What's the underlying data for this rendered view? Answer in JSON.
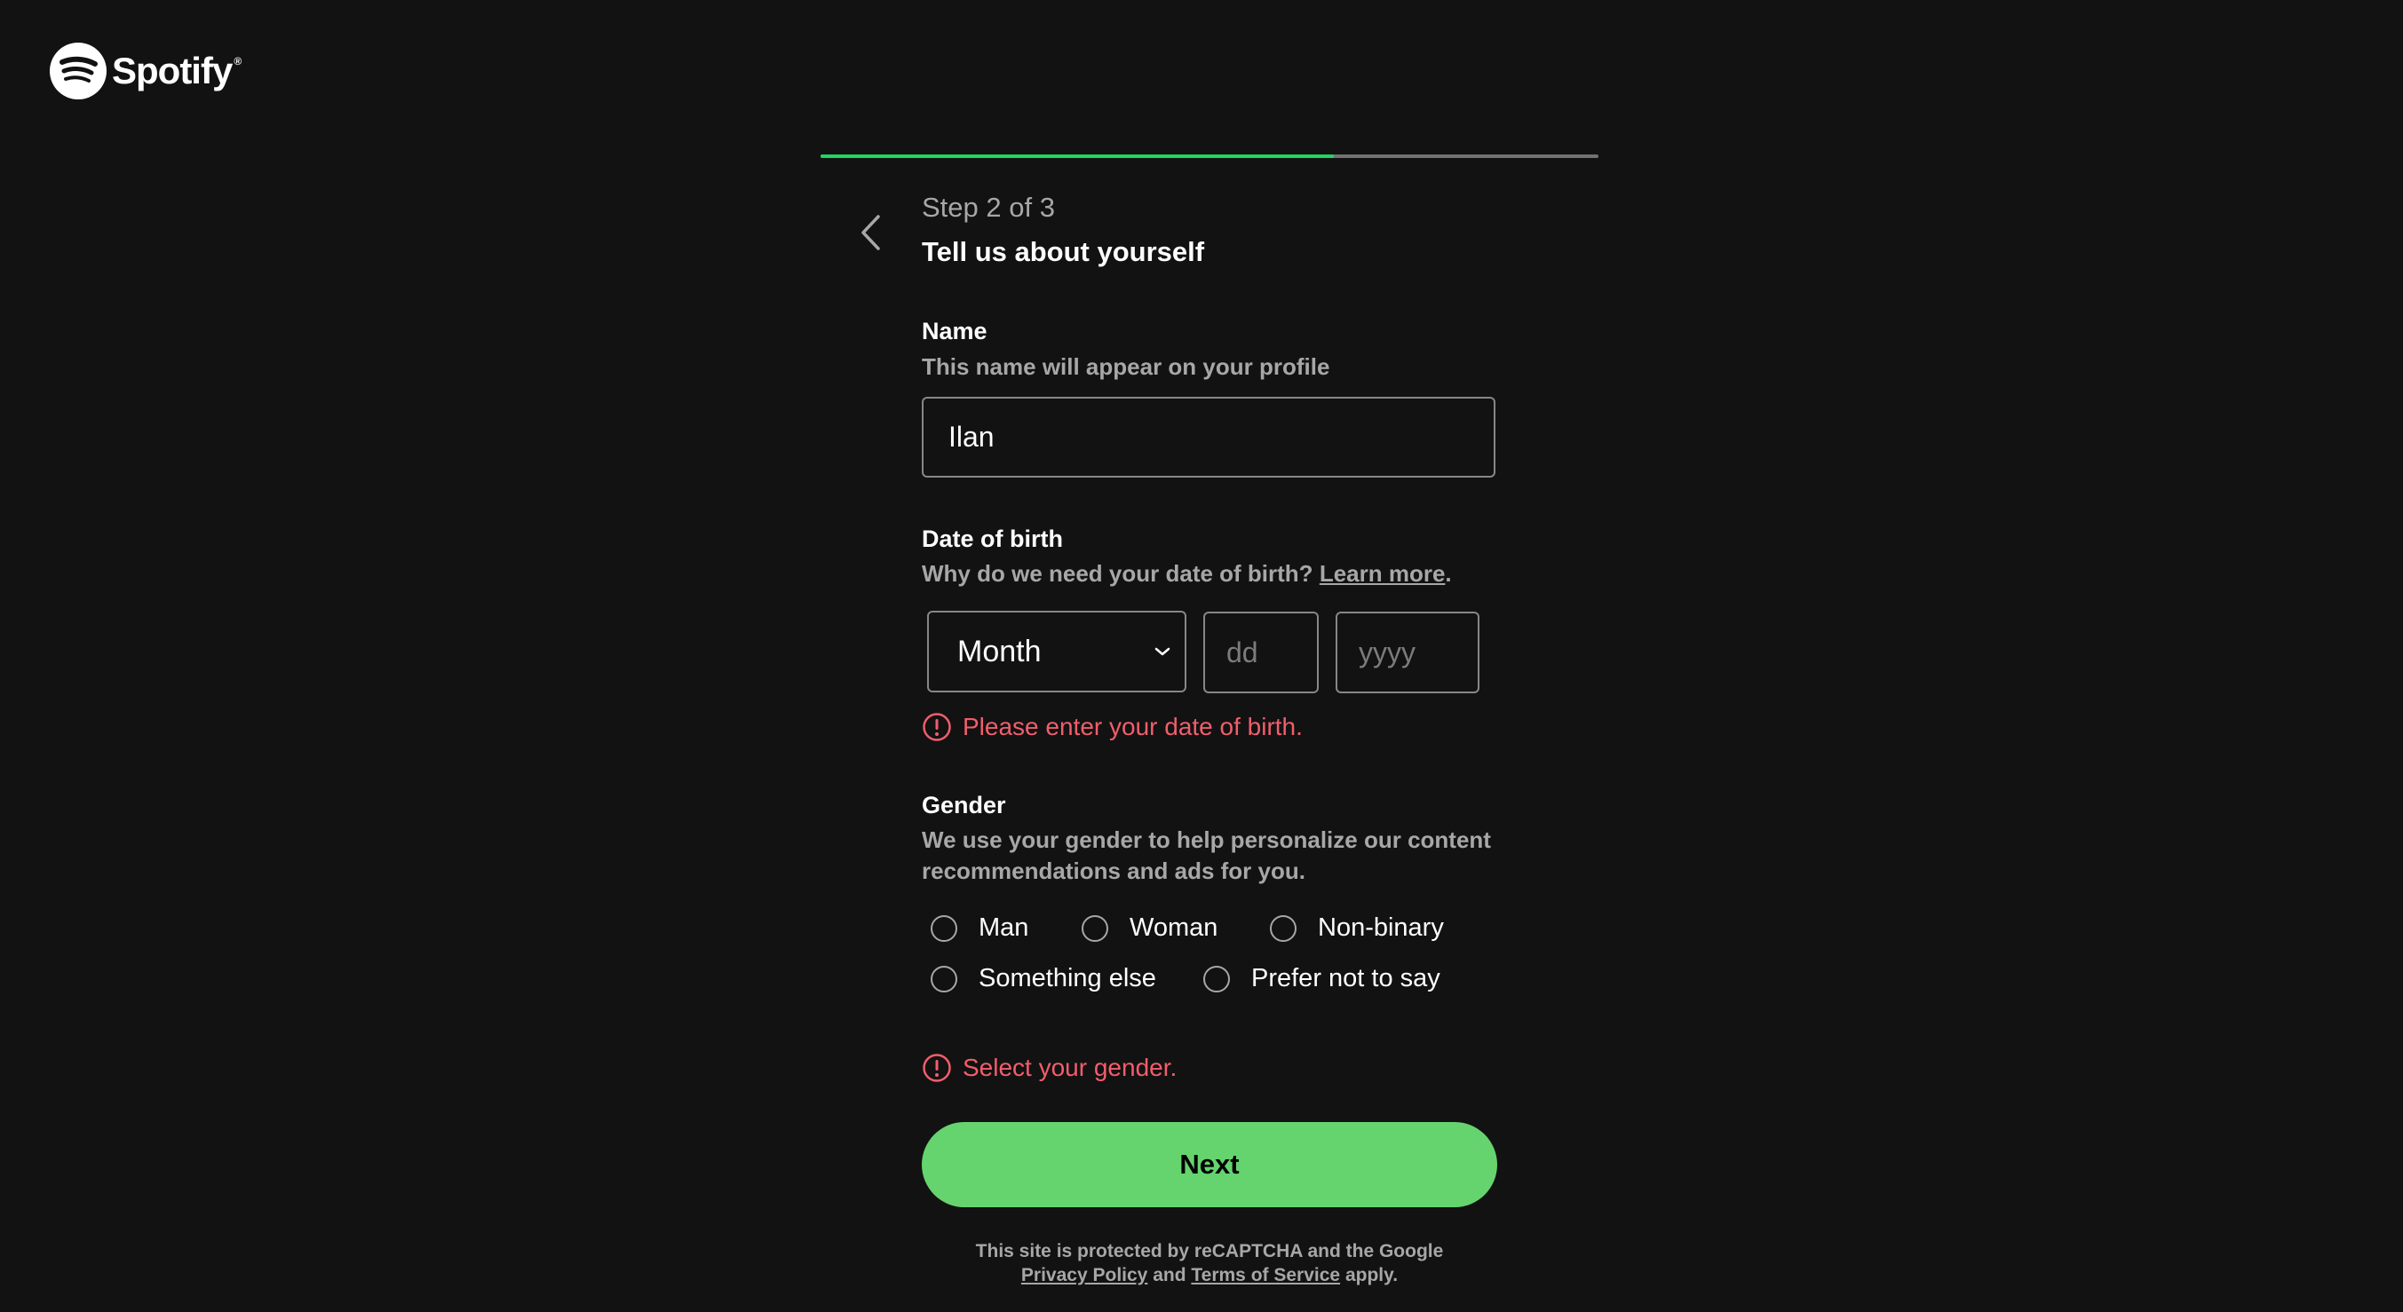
{
  "brand": {
    "name": "Spotify",
    "registered_mark": "®",
    "accent_color": "#1ed760",
    "button_color": "#65d46e",
    "error_color": "#f15e6c"
  },
  "progress": {
    "current_step": 2,
    "total_steps": 3,
    "fraction": 0.66
  },
  "header": {
    "step_label": "Step 2 of 3",
    "title": "Tell us about yourself"
  },
  "name_field": {
    "label": "Name",
    "help": "This name will appear on your profile",
    "value": "Ilan"
  },
  "dob_field": {
    "label": "Date of birth",
    "help": "Why do we need your date of birth?",
    "learn_more": "Learn more",
    "help_suffix": ".",
    "month": "Month",
    "day_placeholder": "dd",
    "year_placeholder": "yyyy",
    "error": "Please enter your date of birth."
  },
  "gender_field": {
    "label": "Gender",
    "help": "We use your gender to help personalize our content recommendations and ads for you.",
    "options": [
      "Man",
      "Woman",
      "Non-binary",
      "Something else",
      "Prefer not to say"
    ],
    "error": "Select your gender."
  },
  "actions": {
    "next": "Next"
  },
  "footer": {
    "line1": "This site is protected by reCAPTCHA and the Google",
    "privacy": "Privacy Policy",
    "and": "and",
    "terms": "Terms of Service",
    "apply": "apply."
  }
}
